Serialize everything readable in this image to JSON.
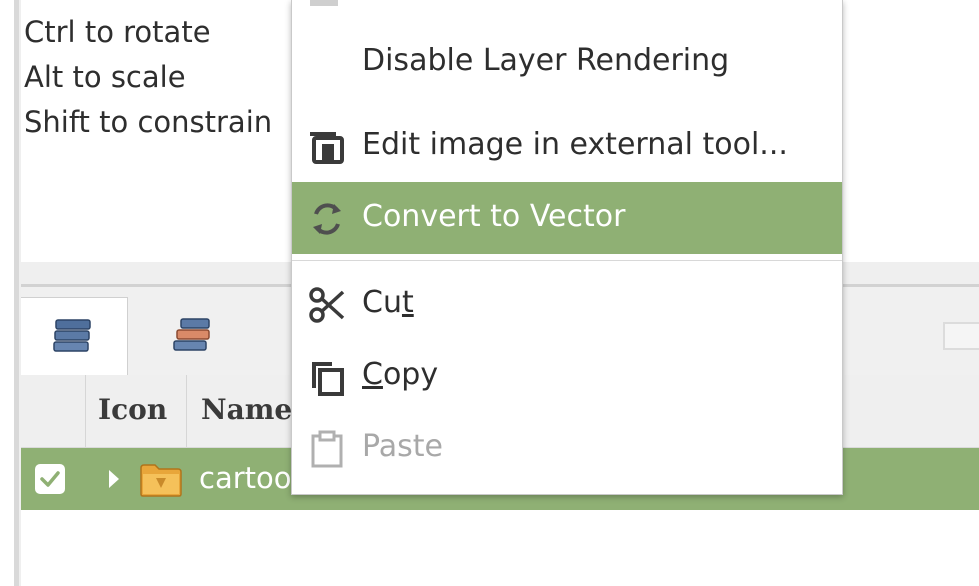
{
  "hints": {
    "line1": "Ctrl to rotate",
    "line2": "Alt to scale",
    "line3": "Shift to constrain"
  },
  "layers_panel": {
    "tabs": [
      {
        "icon": "layers-icon",
        "active": true
      },
      {
        "icon": "objects-icon",
        "active": false
      }
    ],
    "columns": {
      "icon": "Icon",
      "name": "Name"
    },
    "row": {
      "checked": true,
      "icon": "folder-icon",
      "name": "cartoo"
    },
    "selection_color": "#8fb074"
  },
  "context_menu": {
    "items": [
      {
        "label": "Disable Layer Rendering",
        "icon": "",
        "state": "normal"
      },
      {
        "label": "Edit image in external tool...",
        "icon": "external-edit-icon",
        "state": "normal"
      },
      {
        "label": "Convert to Vector",
        "icon": "convert-icon",
        "state": "highlighted"
      },
      {
        "label_before": "Cu",
        "label_mnemonic": "t",
        "label_after": "",
        "icon": "scissors-icon",
        "state": "normal"
      },
      {
        "label_before": "",
        "label_mnemonic": "C",
        "label_after": "opy",
        "icon": "copy-icon",
        "state": "normal"
      },
      {
        "label": "Paste",
        "icon": "paste-icon",
        "state": "disabled"
      }
    ],
    "highlight_color": "#8fb074"
  }
}
